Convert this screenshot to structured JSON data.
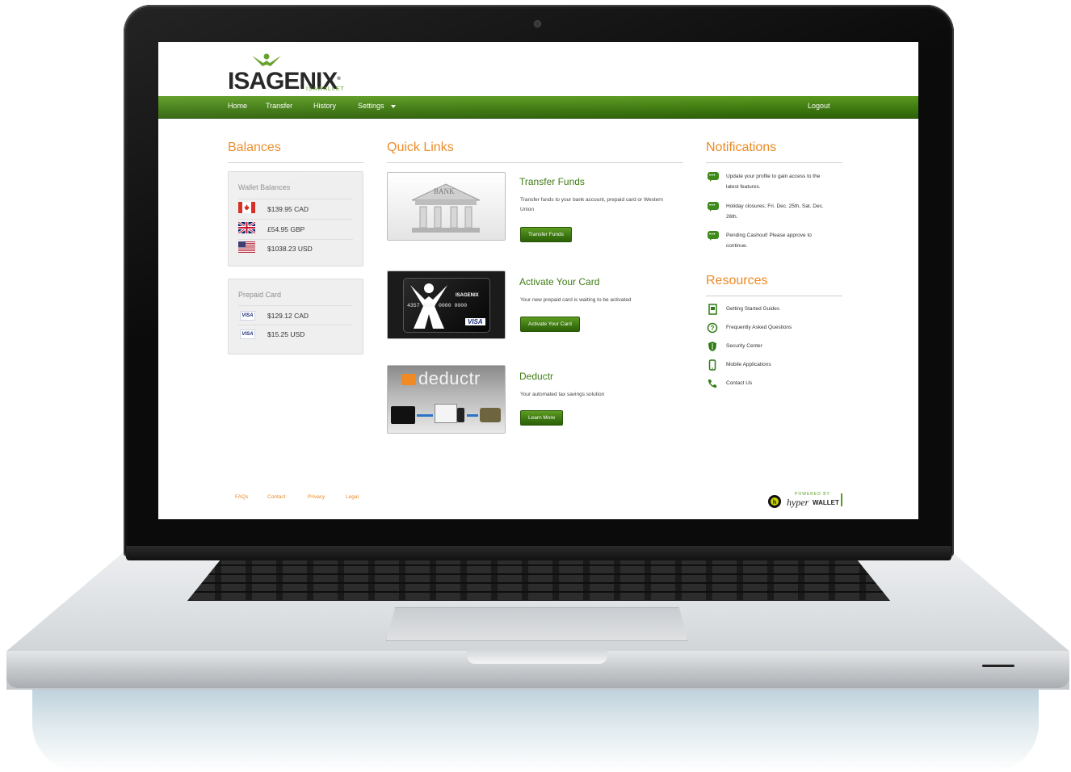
{
  "brand": {
    "logo_text": "ISAGENIX",
    "logo_registered": "®",
    "logo_subtitle": "ISAWALLET"
  },
  "nav": {
    "items": [
      {
        "label": "Home"
      },
      {
        "label": "Transfer"
      },
      {
        "label": "History"
      },
      {
        "label": "Settings"
      }
    ],
    "logout": "Logout"
  },
  "balances": {
    "title": "Balances",
    "wallet": {
      "title": "Wallet Balances",
      "rows": [
        {
          "flag": "canada-flag-icon",
          "amount": "$139.95 CAD"
        },
        {
          "flag": "uk-flag-icon",
          "amount": "£54.95 GBP"
        },
        {
          "flag": "us-flag-icon",
          "amount": "$1038.23 USD"
        }
      ]
    },
    "prepaid": {
      "title": "Prepaid Card",
      "rows": [
        {
          "badge": "VISA",
          "amount": "$129.12 CAD"
        },
        {
          "badge": "VISA",
          "amount": "$15.25 USD"
        }
      ]
    }
  },
  "quick_links": {
    "title": "Quick Links",
    "items": [
      {
        "title": "Transfer Funds",
        "description": "Transfer funds to your bank account, prepaid card or Western Union",
        "button": "Transfer Funds",
        "image_label": "BANK"
      },
      {
        "title": "Activate Your Card",
        "description": "Your new prepaid card is waiting to be activated",
        "button": "Activate Your Card",
        "image_label": "ISAGENIX",
        "card_number": "4357 4100 0000 0000",
        "card_brand": "VISA"
      },
      {
        "title": "Deductr",
        "description": "Your automated tax savings solution",
        "button": "Learn More",
        "image_label": "deductr"
      }
    ]
  },
  "notifications": {
    "title": "Notifications",
    "items": [
      {
        "text": "Update your profile to gain access to the latest features."
      },
      {
        "text": "Holiday closures; Fri. Dec. 25th, Sat. Dec. 26th."
      },
      {
        "text": "Pending Cashout! Please approve to continue."
      }
    ]
  },
  "resources": {
    "title": "Resources",
    "items": [
      {
        "icon": "guide-icon",
        "label": "Getting Started Guides"
      },
      {
        "icon": "question-icon",
        "label": "Frequently Asked Questions"
      },
      {
        "icon": "shield-icon",
        "label": "Security Center"
      },
      {
        "icon": "mobile-icon",
        "label": "Mobile Applications"
      },
      {
        "icon": "phone-icon",
        "label": "Contact Us"
      }
    ]
  },
  "footer": {
    "links": [
      "FAQs",
      "Contact",
      "Privacy",
      "Legal"
    ],
    "powered_by": "POWERED BY",
    "powered_brand_a": "hyper",
    "powered_brand_b": "WALLET"
  },
  "colors": {
    "accent_orange": "#ec8a24",
    "nav_green": "#3f7a10",
    "title_green": "#3e7c12"
  }
}
